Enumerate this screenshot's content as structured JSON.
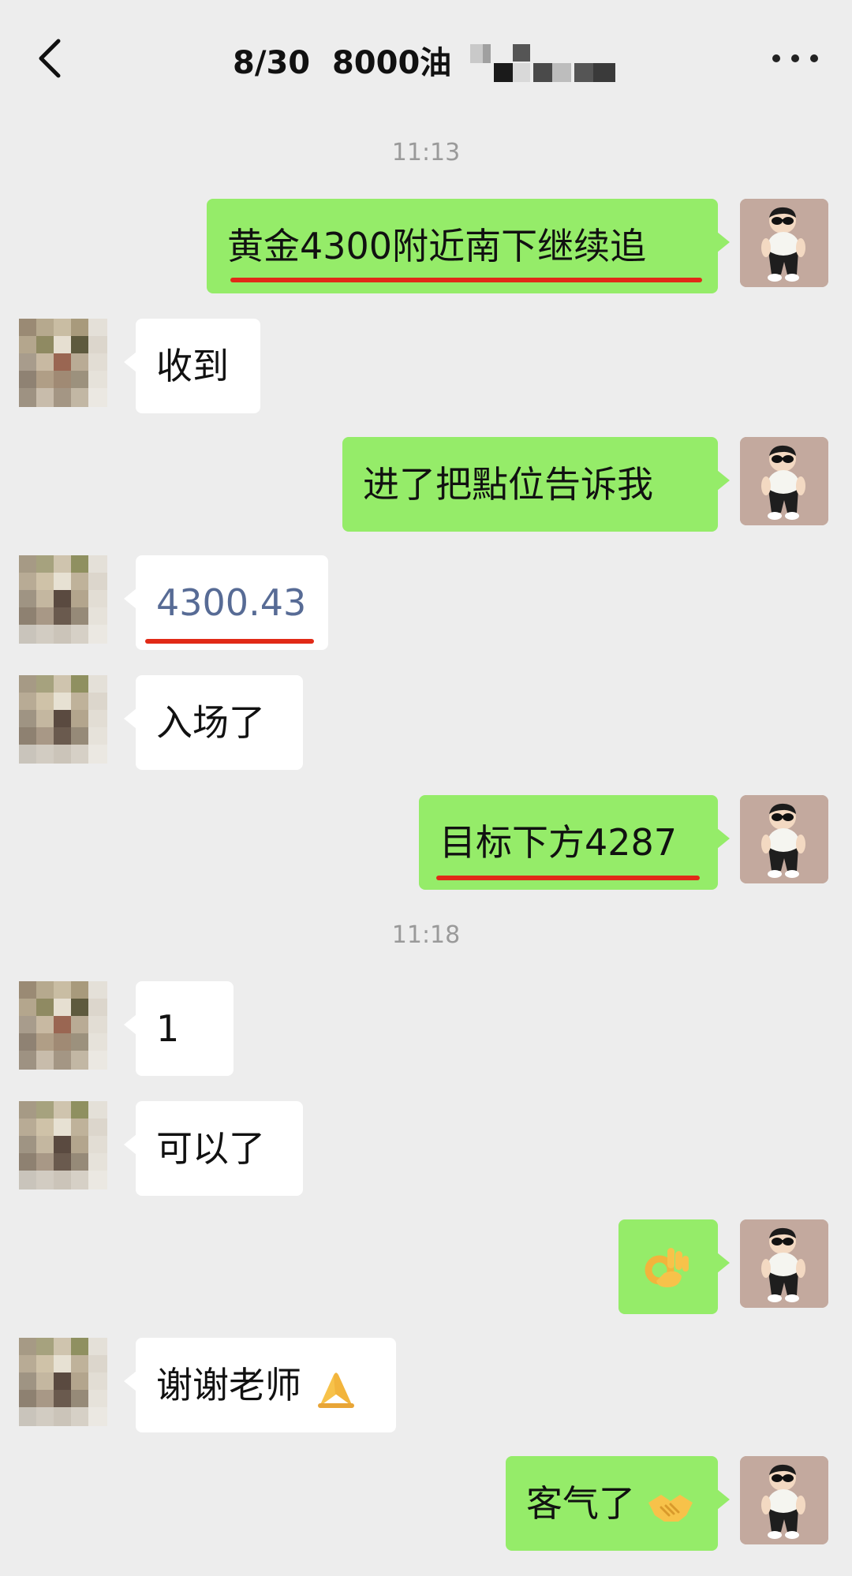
{
  "header": {
    "title": "8/30  8000油",
    "back_icon": "chevron-left-icon",
    "more_icon": "more-horizontal-icon",
    "title_suffix_redacted": "mosaic"
  },
  "messages": [
    {
      "type": "time",
      "text": "11:13"
    },
    {
      "type": "sent",
      "text": "黄金4300附近南下继续追",
      "highlight": "red-underline"
    },
    {
      "type": "received",
      "text": "收到"
    },
    {
      "type": "sent",
      "text": "进了把點位告诉我"
    },
    {
      "type": "received",
      "text": "4300.43",
      "highlight": "red-underline"
    },
    {
      "type": "received",
      "text": "入场了"
    },
    {
      "type": "sent",
      "text": "目标下方4287",
      "highlight": "red-underline"
    },
    {
      "type": "time",
      "text": "11:18"
    },
    {
      "type": "received",
      "text": "1"
    },
    {
      "type": "received",
      "text": "可以了"
    },
    {
      "type": "sent",
      "emoji": "ok-hand-emoji"
    },
    {
      "type": "received",
      "text": "谢谢老师",
      "emoji": "pray-emoji"
    },
    {
      "type": "sent",
      "text": "客气了",
      "emoji": "handshake-emoji"
    }
  ],
  "colors": {
    "background": "#ededed",
    "sent_bubble": "#95ec69",
    "received_bubble": "#ffffff",
    "timestamp": "#9a9a9a",
    "link_number": "#576b95",
    "underline": "#e12a17"
  }
}
